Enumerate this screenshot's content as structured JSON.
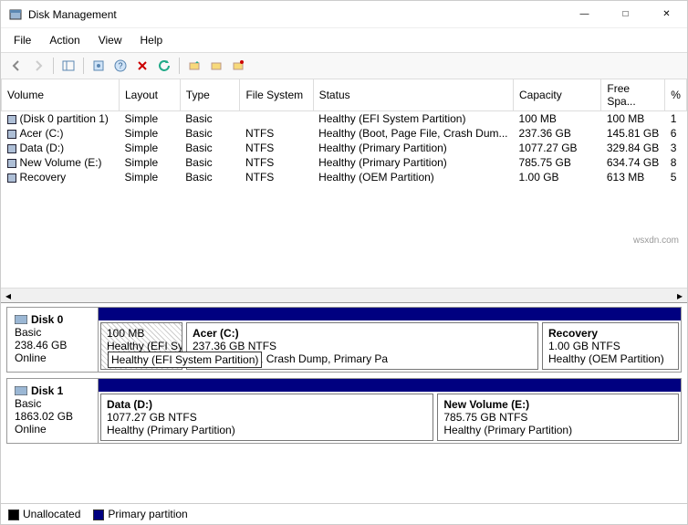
{
  "window": {
    "title": "Disk Management"
  },
  "menu": {
    "file": "File",
    "action": "Action",
    "view": "View",
    "help": "Help"
  },
  "columns": {
    "volume": "Volume",
    "layout": "Layout",
    "type": "Type",
    "filesystem": "File System",
    "status": "Status",
    "capacity": "Capacity",
    "freespace": "Free Spa...",
    "pct": "%"
  },
  "volumes": [
    {
      "name": "(Disk 0 partition 1)",
      "layout": "Simple",
      "type": "Basic",
      "fs": "",
      "status": "Healthy (EFI System Partition)",
      "capacity": "100 MB",
      "free": "100 MB",
      "pct": "1"
    },
    {
      "name": "Acer (C:)",
      "layout": "Simple",
      "type": "Basic",
      "fs": "NTFS",
      "status": "Healthy (Boot, Page File, Crash Dum...",
      "capacity": "237.36 GB",
      "free": "145.81 GB",
      "pct": "6"
    },
    {
      "name": "Data (D:)",
      "layout": "Simple",
      "type": "Basic",
      "fs": "NTFS",
      "status": "Healthy (Primary Partition)",
      "capacity": "1077.27 GB",
      "free": "329.84 GB",
      "pct": "3"
    },
    {
      "name": "New Volume (E:)",
      "layout": "Simple",
      "type": "Basic",
      "fs": "NTFS",
      "status": "Healthy (Primary Partition)",
      "capacity": "785.75 GB",
      "free": "634.74 GB",
      "pct": "8"
    },
    {
      "name": "Recovery",
      "layout": "Simple",
      "type": "Basic",
      "fs": "NTFS",
      "status": "Healthy (OEM Partition)",
      "capacity": "1.00 GB",
      "free": "613 MB",
      "pct": "5"
    }
  ],
  "disks": [
    {
      "name": "Disk 0",
      "type": "Basic",
      "size": "238.46 GB",
      "status": "Online",
      "partitions": [
        {
          "name": "",
          "info": "100 MB",
          "status": "Healthy (EFI System Partition)",
          "class": "efi",
          "flex": "0 0 90px"
        },
        {
          "name": "Acer  (C:)",
          "info": "237.36 GB NTFS",
          "status": "oot, Page File, Crash Dump, Primary Pa",
          "class": "",
          "flex": "1 1 320px"
        },
        {
          "name": "Recovery",
          "info": "1.00 GB NTFS",
          "status": "Healthy (OEM Partition)",
          "class": "",
          "flex": "0 0 150px"
        }
      ]
    },
    {
      "name": "Disk 1",
      "type": "Basic",
      "size": "1863.02 GB",
      "status": "Online",
      "partitions": [
        {
          "name": "Data  (D:)",
          "info": "1077.27 GB NTFS",
          "status": "Healthy (Primary Partition)",
          "class": "",
          "flex": "1 1 58%"
        },
        {
          "name": "New Volume  (E:)",
          "info": "785.75 GB NTFS",
          "status": "Healthy (Primary Partition)",
          "class": "",
          "flex": "1 1 42%"
        }
      ]
    }
  ],
  "legend": {
    "unallocated": "Unallocated",
    "primary": "Primary partition"
  },
  "tooltip": "Healthy (EFI System Partition)",
  "watermark": "wsxdn.com"
}
